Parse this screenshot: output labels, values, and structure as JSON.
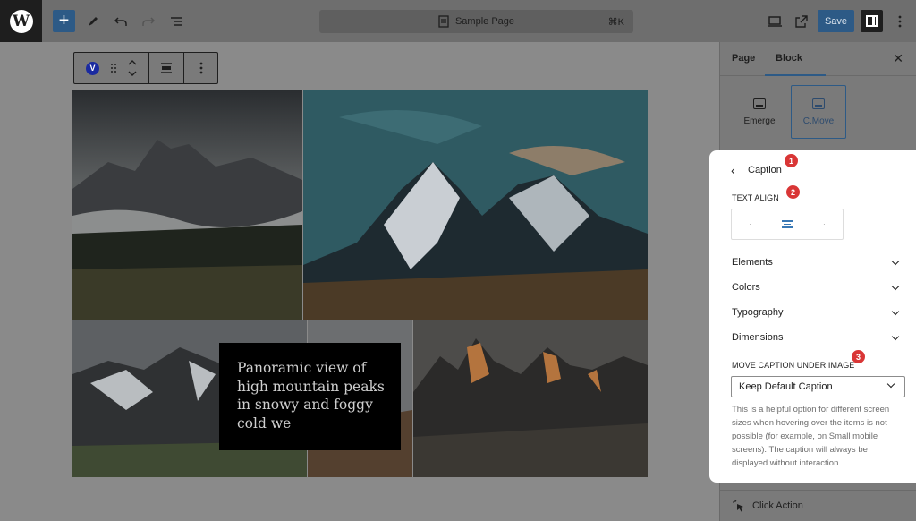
{
  "topbar": {
    "document_title": "Sample Page",
    "shortcut": "⌘K",
    "save_label": "Save",
    "add_symbol": "+",
    "icons": [
      "wordpress-logo",
      "add-block",
      "tools-pencil",
      "undo",
      "redo",
      "document-overview",
      "view-desktop",
      "view-external",
      "settings-toggle",
      "options-more"
    ]
  },
  "block_toolbar": {
    "block_badge": "V"
  },
  "gallery": {
    "caption": "Panoramic view of high mountain peaks in snowy and foggy cold we"
  },
  "sidebar": {
    "tabs": [
      "Page",
      "Block"
    ],
    "active_tab": "Block",
    "styles": [
      {
        "label": "Emerge",
        "selected": false
      },
      {
        "label": "C.Move",
        "selected": true
      }
    ],
    "click_action_label": "Click Action"
  },
  "panel": {
    "title": "Caption",
    "text_align_label": "TEXT ALIGN",
    "text_align_selected": "center",
    "accordions": [
      "Elements",
      "Colors",
      "Typography",
      "Dimensions"
    ],
    "move_caption_label": "MOVE CAPTION UNDER IMAGE",
    "move_caption_value": "Keep Default Caption",
    "help_text": "This is a helpful option for different screen sizes when hovering over the items is not possible (for example, on Small mobile screens). The caption will always be displayed without interaction.",
    "badges": [
      "1",
      "2",
      "3"
    ]
  },
  "colors": {
    "accent": "#2d5a86",
    "badge_red": "#d93636",
    "block_badge": "#1a2aa0"
  }
}
